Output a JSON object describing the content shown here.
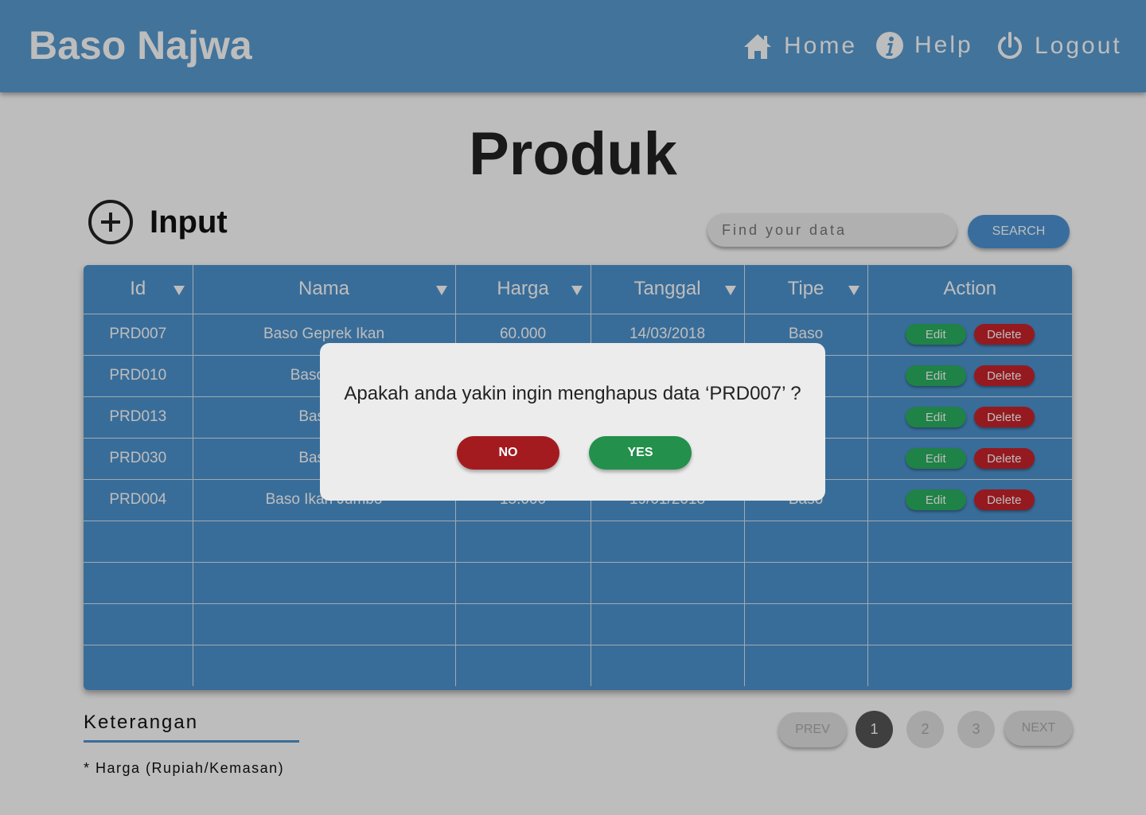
{
  "header": {
    "brand": "Baso Najwa",
    "nav": {
      "home": "Home",
      "help": "Help",
      "logout": "Logout"
    }
  },
  "page": {
    "title": "Produk"
  },
  "toolbar": {
    "input_label": "Input",
    "search_placeholder": "Find your data",
    "search_label": "SEARCH"
  },
  "table": {
    "columns": [
      "Id",
      "Nama",
      "Harga",
      "Tanggal",
      "Tipe",
      "Action"
    ],
    "rows": [
      {
        "id": "PRD007",
        "nama": "Baso Geprek Ikan",
        "harga": "60.000",
        "tanggal": "14/03/2018",
        "tipe": "Baso"
      },
      {
        "id": "PRD010",
        "nama": "Baso Ikan",
        "harga": "",
        "tanggal": "",
        "tipe": ""
      },
      {
        "id": "PRD013",
        "nama": "Baso Ik",
        "harga": "",
        "tanggal": "",
        "tipe": ""
      },
      {
        "id": "PRD030",
        "nama": "Baso Ik",
        "harga": "",
        "tanggal": "",
        "tipe": ""
      },
      {
        "id": "PRD004",
        "nama": "Baso Ikan Jumbo",
        "harga": "15.000",
        "tanggal": "19/01/2018",
        "tipe": "Baso"
      }
    ],
    "edit_label": "Edit",
    "delete_label": "Delete"
  },
  "footer": {
    "keterangan_title": "Keterangan",
    "note": "* Harga (Rupiah/Kemasan)"
  },
  "pagination": {
    "prev": "PREV",
    "next": "NEXT",
    "pages": [
      "1",
      "2",
      "3"
    ],
    "current": "1"
  },
  "modal": {
    "message": "Apakah anda yakin ingin menghapus data ‘PRD007’ ?",
    "no_label": "NO",
    "yes_label": "YES"
  },
  "colors": {
    "header": "#5a9bd0",
    "table": "#4e93cf",
    "edit": "#2ab060",
    "delete": "#c8242a",
    "no": "#a31b1f",
    "yes": "#23904c"
  },
  "icons": {
    "home": "home-icon",
    "help": "info-icon",
    "logout": "power-icon",
    "input": "plus-circle-icon"
  }
}
